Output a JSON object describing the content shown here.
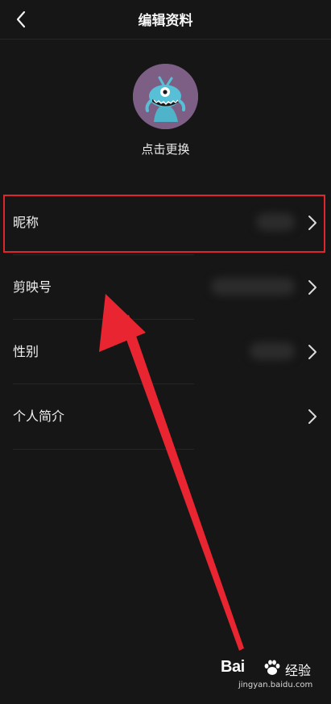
{
  "header": {
    "title": "编辑资料"
  },
  "avatar": {
    "change_label": "点击更换",
    "bg_color": "#7d5f86"
  },
  "rows": [
    {
      "label": "昵称",
      "value": ""
    },
    {
      "label": "剪映号",
      "value": ""
    },
    {
      "label": "性别",
      "value": ""
    },
    {
      "label": "个人简介",
      "value": ""
    }
  ],
  "annotation": {
    "highlight_color": "#e0262d"
  },
  "watermark": {
    "brand": "Bai",
    "suffix": "经验",
    "url": "jingyan.baidu.com"
  }
}
